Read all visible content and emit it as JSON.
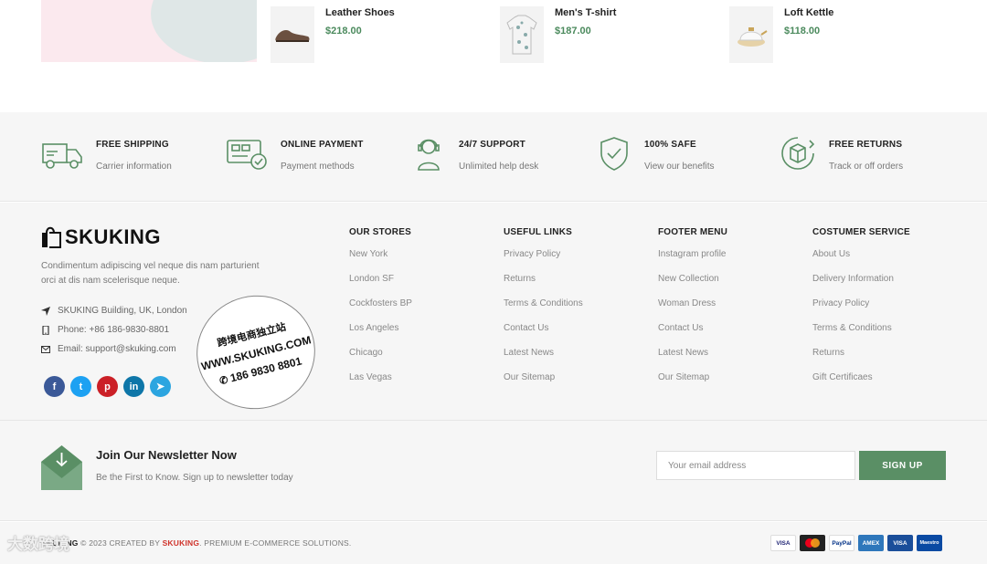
{
  "products": [
    {
      "name": "Leather Shoes",
      "price": "$218.00",
      "icon": "shoe-icon"
    },
    {
      "name": "Men's T-shirt",
      "price": "$187.00",
      "icon": "tshirt-icon"
    },
    {
      "name": "Loft Kettle",
      "price": "$118.00",
      "icon": "kettle-icon"
    }
  ],
  "features": [
    {
      "title": "FREE SHIPPING",
      "subtitle": "Carrier information",
      "icon": "truck-icon"
    },
    {
      "title": "ONLINE PAYMENT",
      "subtitle": "Payment methods",
      "icon": "credit-card-icon"
    },
    {
      "title": "24/7 SUPPORT",
      "subtitle": "Unlimited help desk",
      "icon": "headset-icon"
    },
    {
      "title": "100% SAFE",
      "subtitle": "View our benefits",
      "icon": "shield-check-icon"
    },
    {
      "title": "FREE RETURNS",
      "subtitle": "Track or off orders",
      "icon": "return-box-icon"
    }
  ],
  "brand": {
    "name": "SKUKING",
    "about": "Condimentum adipiscing vel neque dis nam parturient orci at dis nam scelerisque neque.",
    "address": "SKUKING Building, UK, London",
    "phone": "Phone: +86 186-9830-8801",
    "email": "Email: support@skuking.com",
    "socials": [
      "facebook-icon",
      "twitter-icon",
      "pinterest-icon",
      "linkedin-icon",
      "telegram-icon"
    ]
  },
  "columns": [
    {
      "title": "OUR STORES",
      "links": [
        "New York",
        "London SF",
        "Cockfosters BP",
        "Los Angeles",
        "Chicago",
        "Las Vegas"
      ]
    },
    {
      "title": "USEFUL LINKS",
      "links": [
        "Privacy Policy",
        "Returns",
        "Terms & Conditions",
        "Contact Us",
        "Latest News",
        "Our Sitemap"
      ]
    },
    {
      "title": "FOOTER MENU",
      "links": [
        "Instagram profile",
        "New Collection",
        "Woman Dress",
        "Contact Us",
        "Latest News",
        "Our Sitemap"
      ]
    },
    {
      "title": "COSTUMER SERVICE",
      "links": [
        "About Us",
        "Delivery Information",
        "Privacy Policy",
        "Terms & Conditions",
        "Returns",
        "Gift Certificaes"
      ]
    }
  ],
  "stamp": {
    "line1": "跨境电商独立站",
    "line2": "WWW.SKUKING.COM",
    "line3": "186 9830 8801"
  },
  "newsletter": {
    "title": "Join Our Newsletter Now",
    "subtitle": "Be the First to Know. Sign up to newsletter today",
    "placeholder": "Your email address",
    "button": "SIGN UP"
  },
  "bottom": {
    "copyright_brand": "SKUKING",
    "copyright_mid": " © 2023 CREATED BY ",
    "copyright_link": "SKUKING",
    "copyright_tail": ". PREMIUM E-COMMERCE SOLUTIONS.",
    "payments": [
      "VISA",
      "MC",
      "PayPal",
      "AMEX",
      "VISA",
      "Maestro"
    ]
  },
  "watermark": "大数跨境",
  "colors": {
    "accent": "#5a8f65",
    "price": "#4b8a5d",
    "red": "#d0342c"
  }
}
